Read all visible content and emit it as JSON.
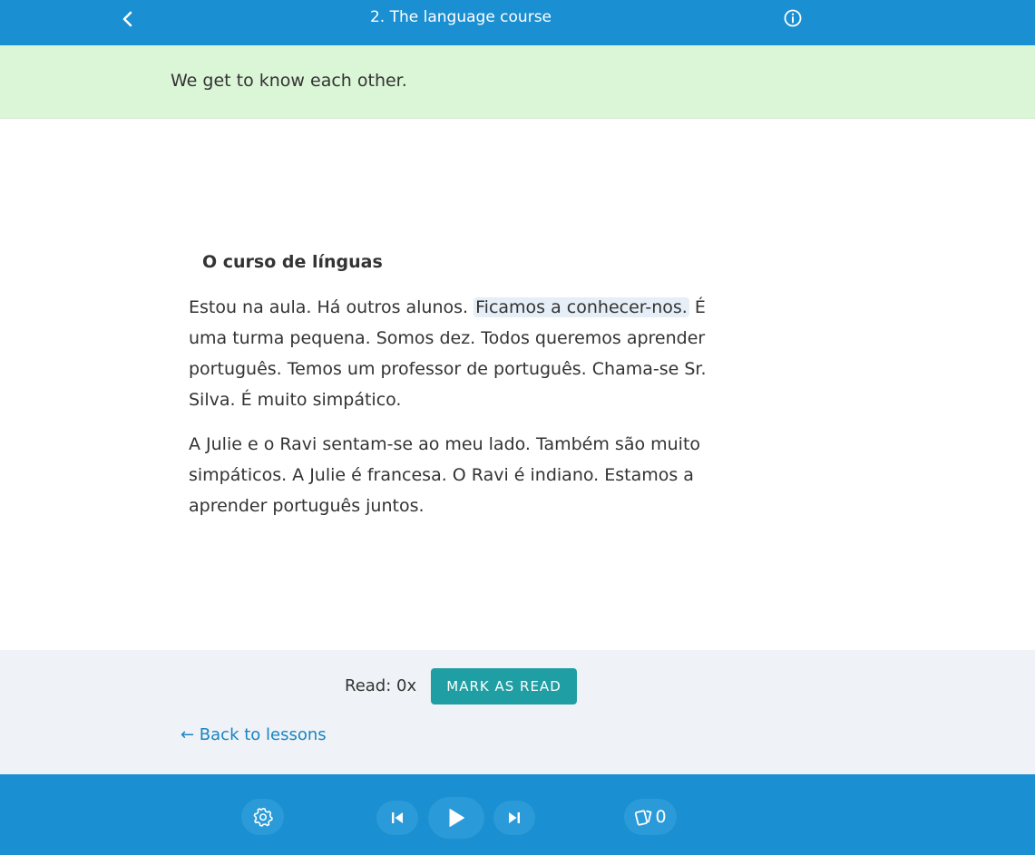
{
  "header": {
    "title": "2. The language course",
    "back_icon": "chevron-left-icon",
    "info_icon": "info-icon"
  },
  "summary": {
    "text": "We get to know each other."
  },
  "lesson": {
    "heading": "O curso de línguas",
    "paragraph1": {
      "before": "Estou na aula. Há outros alunos. ",
      "highlighted": "Ficamos a conhecer-nos.",
      "after": " É uma turma pequena. Somos dez. Todos queremos aprender português. Temos um professor de português. Chama-se Sr. Silva. É muito simpático."
    },
    "paragraph2": "A Julie e o Ravi sentam-se ao meu lado. Também são muito simpáticos. A Julie é francesa. O Ravi é indiano. Estamos a aprender português juntos."
  },
  "footer": {
    "read_count": "Read: 0x",
    "mark_as_read_label": "MARK AS READ",
    "back_to_lessons": "← Back to lessons"
  },
  "player": {
    "settings_icon": "gear-icon",
    "prev_icon": "skip-previous-icon",
    "play_icon": "play-icon",
    "next_icon": "skip-next-icon",
    "cards_icon": "flashcards-icon",
    "cards_count": "0"
  },
  "colors": {
    "header_bg": "#1a8fd1",
    "summary_bg": "#dbf5d7",
    "footer_bg": "#eff2f6",
    "button_teal": "#1f9ea3",
    "link_blue": "#1a84c2",
    "highlight": "#e6eef7"
  }
}
